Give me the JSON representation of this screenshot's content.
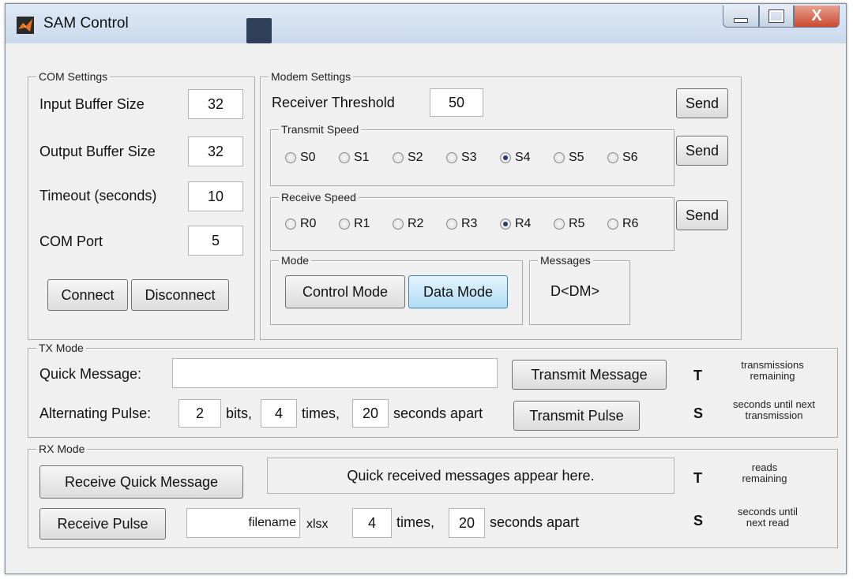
{
  "window": {
    "title": "SAM Control",
    "close_label": "X"
  },
  "com_settings": {
    "legend": "COM Settings",
    "input_buffer_label": "Input Buffer Size",
    "input_buffer_value": "32",
    "output_buffer_label": "Output Buffer Size",
    "output_buffer_value": "32",
    "timeout_label": "Timeout (seconds)",
    "timeout_value": "10",
    "com_port_label": "COM Port",
    "com_port_value": "5",
    "connect_label": "Connect",
    "disconnect_label": "Disconnect"
  },
  "modem_settings": {
    "legend": "Modem Settings",
    "threshold_label": "Receiver Threshold",
    "threshold_value": "50",
    "send_label": "Send",
    "transmit_speed": {
      "legend": "Transmit Speed",
      "options": [
        "S0",
        "S1",
        "S2",
        "S3",
        "S4",
        "S5",
        "S6"
      ],
      "selected": "S4"
    },
    "receive_speed": {
      "legend": "Receive Speed",
      "options": [
        "R0",
        "R1",
        "R2",
        "R3",
        "R4",
        "R5",
        "R6"
      ],
      "selected": "R4"
    },
    "mode": {
      "legend": "Mode",
      "control_label": "Control Mode",
      "data_label": "Data Mode",
      "active": "Data Mode"
    },
    "messages": {
      "legend": "Messages",
      "value": "D<DM>"
    }
  },
  "tx_mode": {
    "legend": "TX Mode",
    "quick_message_label": "Quick Message:",
    "quick_message_value": "",
    "transmit_message_label": "Transmit Message",
    "pulse_label": "Alternating Pulse:",
    "bits_value": "2",
    "bits_label": "bits,",
    "times_value": "4",
    "times_label": "times,",
    "seconds_value": "20",
    "seconds_label": "seconds apart",
    "transmit_pulse_label": "Transmit Pulse",
    "t_label": "T",
    "t_desc": "transmissions remaining",
    "s_label": "S",
    "s_desc": "seconds until next transmission"
  },
  "rx_mode": {
    "legend": "RX Mode",
    "receive_quick_label": "Receive Quick Message",
    "quick_display": "Quick received messages appear here.",
    "receive_pulse_label": "Receive Pulse",
    "filename_value": "filename",
    "extension_label": "xlsx",
    "times_value": "4",
    "times_label": "times,",
    "seconds_value": "20",
    "seconds_label": "seconds apart",
    "t_label": "T",
    "t_desc": "reads remaining",
    "s_label": "S",
    "s_desc": "seconds until next read"
  }
}
